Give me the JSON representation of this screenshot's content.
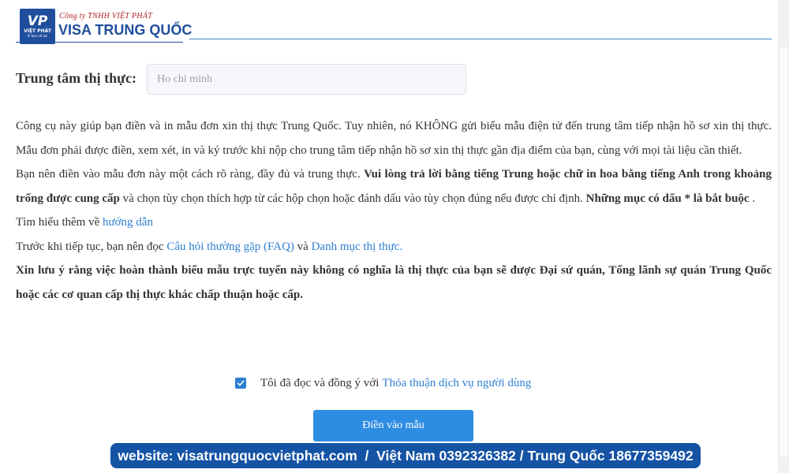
{
  "header": {
    "logo_mark": "VP",
    "logo_name": "VIỆT PHÁT",
    "logo_slogan": "Vì bạn nỗ lực",
    "company_name": "Công ty TNHH VIỆT PHÁT",
    "brand_title": "VISA TRUNG QUỐC"
  },
  "visa_center": {
    "label": "Trung tâm thị thực:",
    "placeholder": "Ho chi minh",
    "value": ""
  },
  "content": {
    "p1": "Công cụ này giúp bạn điền và in mẫu đơn xin thị thực Trung Quốc. Tuy nhiên, nó KHÔNG gửi biểu mẫu điện tử đến trung tâm tiếp nhận hồ sơ xin thị thực. Mẫu đơn phải được điền, xem xét, in và ký trước khi nộp cho trung tâm tiếp nhận hồ sơ xin thị thực gần địa điểm của bạn, cùng với mọi tài liệu cần thiết.",
    "p2_a": "Bạn nên điền vào mẫu đơn này một cách rõ ràng, đầy đủ và trung thực. ",
    "p2_b": "Vui lòng trả lời bằng tiếng Trung hoặc chữ in hoa bằng tiếng Anh trong khoảng trống được cung cấp",
    "p2_c": " và chọn tùy chọn thích hợp từ các hộp chọn hoặc đánh dấu vào tùy chọn đúng nếu được chỉ định. ",
    "p2_d": "Những mục có dấu * là bắt buộc",
    "p2_e": " .",
    "p3_text": "Tìm hiểu thêm về ",
    "p3_link": "hướng dẫn",
    "p4_text": "Trước khi tiếp tục, bạn nên đọc ",
    "p4_link1": "Câu hỏi thường gặp (FAQ)",
    "p4_and": " và ",
    "p4_link2": "Danh mục thị thực.",
    "p5": "Xin lưu ý rằng việc hoàn thành biểu mẫu trực tuyến này không có nghĩa là thị thực của bạn sẽ được Đại sứ quán, Tổng lãnh sự quán Trung Quốc hoặc các cơ quan cấp thị thực khác chấp thuận hoặc cấp."
  },
  "agreement": {
    "checked": true,
    "text": "Tôi đã đọc và đồng ý với",
    "link": "Thỏa thuận dịch vụ người dùng"
  },
  "submit_label": "Điền vào mẫu",
  "footer": {
    "text": "website: visatrungquocvietphat.com  /  Việt Nam 0392326382 / Trung Quốc 18677359492"
  },
  "colors": {
    "brand_blue": "#1f4e9c",
    "brand_red": "#b01e23",
    "link": "#2d7fd1",
    "button": "#2d8de2",
    "banner": "#1553a5"
  },
  "icons": {
    "checkbox": "check-icon"
  }
}
